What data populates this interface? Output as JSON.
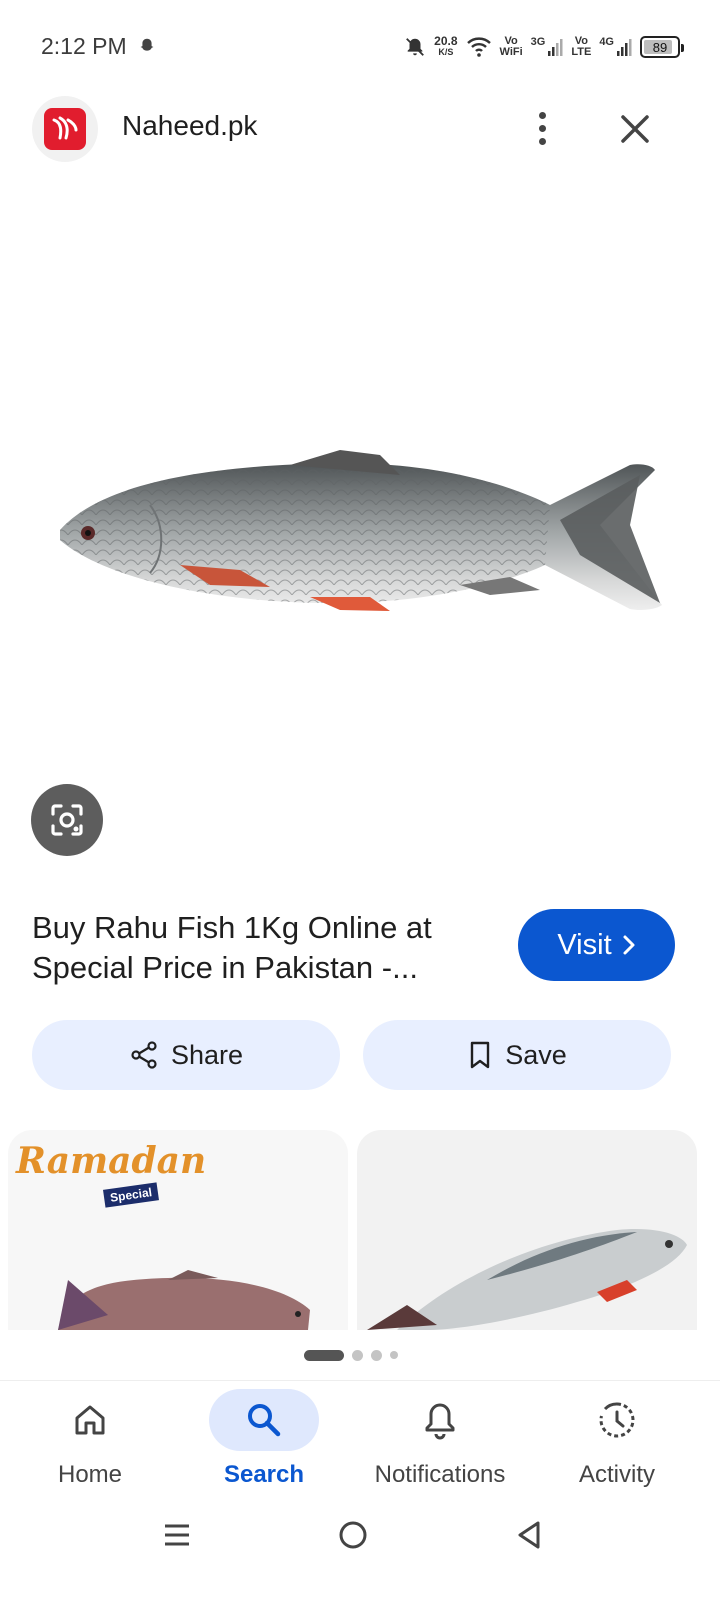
{
  "status_bar": {
    "time": "2:12 PM",
    "net_speed_value": "20.8",
    "net_speed_unit": "K/S",
    "vowifi_top": "Vo",
    "vowifi_bottom": "WiFi",
    "sim1_label": "3G",
    "volte_top": "Vo",
    "volte_bottom": "LTE",
    "sim2_label": "4G",
    "battery_level": "89"
  },
  "header": {
    "site_name": "Naheed.pk"
  },
  "result": {
    "title": "Buy Rahu Fish 1Kg Online at Special Price in Pakistan -...",
    "visit_label": "Visit"
  },
  "actions": {
    "share_label": "Share",
    "save_label": "Save"
  },
  "related": {
    "thumb1_brand": "Ramadan",
    "thumb1_badge": "Special"
  },
  "bottom_nav": {
    "items": [
      {
        "label": "Home",
        "icon": "home-icon"
      },
      {
        "label": "Search",
        "icon": "search-icon"
      },
      {
        "label": "Notifications",
        "icon": "bell-icon"
      },
      {
        "label": "Activity",
        "icon": "activity-icon"
      }
    ],
    "active_index": 1
  },
  "colors": {
    "accent": "#0b57d0",
    "chip_bg": "#e8efff",
    "logo_red": "#e11d2e"
  }
}
